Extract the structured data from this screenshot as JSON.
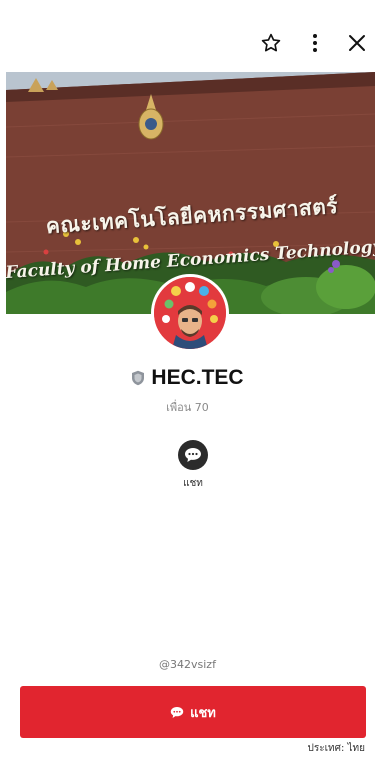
{
  "header": {
    "icons": [
      "star-icon",
      "more-vertical-icon",
      "close-icon"
    ]
  },
  "cover": {
    "sign_thai": "คณะเทคโนโลยีคหกรรมศาสตร์",
    "sign_english": "Faculty of Home Economics Technology"
  },
  "profile": {
    "name": "HEC.TEC",
    "friends_label": "เพื่อน 70",
    "badge_icon": "shield-icon"
  },
  "actions": {
    "chat_label": "แชท"
  },
  "footer": {
    "line_id": "@342vsizf",
    "chat_button_label": "แชท",
    "country_label": "ประเทศ: ไทย"
  },
  "colors": {
    "accent_red": "#e1252f",
    "avatar_red": "#e23a3e",
    "icon_dark": "#2b2b2b"
  }
}
